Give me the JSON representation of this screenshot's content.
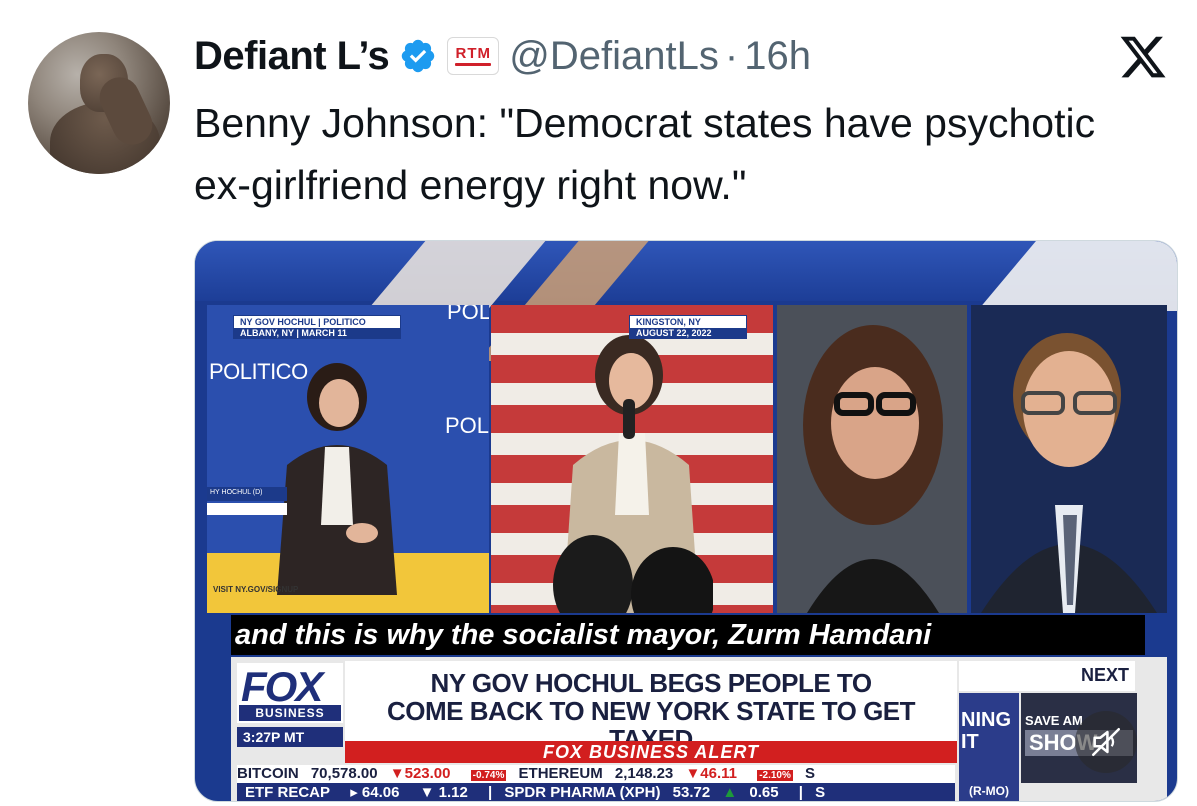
{
  "tweet": {
    "display_name": "Defiant L’s",
    "handle": "@DefiantLs",
    "separator": "·",
    "time": "16h",
    "affiliate_badge": "RTM",
    "text": "Benny Johnson: \"Democrat states have psychotic ex-girlfriend energy right now.\""
  },
  "colors": {
    "verified_blue": "#1d9bf0",
    "text_primary": "#0f1419",
    "text_secondary": "#536471",
    "fox_navy": "#1f2f7a",
    "alert_red": "#d21f1f"
  },
  "icons": {
    "verified": "verified-badge-icon",
    "x_logo": "x-logo-icon",
    "mute": "speaker-muted-icon"
  },
  "video": {
    "panel1": {
      "tag_top": "NY GOV HOCHUL | POLITICO",
      "tag_bottom": "ALBANY, NY | MARCH 11",
      "politico": "POLITICO",
      "politico_partial": "POL",
      "politico_top": "POL",
      "nametag": "HY HOCHUL (D)",
      "visit": "VISIT NY.GOV/SIGNUP"
    },
    "panel2": {
      "tag_top": "KINGSTON, NY",
      "tag_bottom": "AUGUST 22, 2022"
    },
    "caption": "and this is why the socialist mayor, Zurm Hamdani",
    "fox_logo": "FOX",
    "fox_business": "BUSINESS",
    "clock": "3:27P MT",
    "headline_line1": "NY GOV HOCHUL BEGS PEOPLE TO",
    "headline_line2": "COME BACK TO NEW YORK STATE TO GET TAXED",
    "alert": "FOX BUSINESS ALERT",
    "next": "NEXT",
    "promo1": "NING IT",
    "promo2_top": "SAVE AM",
    "promo2_show": "SHOW",
    "rmo": "(R-MO)",
    "ticker1": {
      "bitcoin_label": "BITCOIN",
      "bitcoin_value": "70,578.00",
      "bitcoin_change": "523.00",
      "bitcoin_pct": "-0.74%",
      "eth_label": "ETHEREUM",
      "eth_value": "2,148.23",
      "eth_change": "46.11",
      "eth_pct": "-2.10%",
      "tail": "S"
    },
    "ticker2": {
      "etf_label": "ETF RECAP",
      "v1": "64.06",
      "v2": "1.12",
      "sep": "|",
      "spdr_label": "SPDR PHARMA (XPH)",
      "spdr_value": "53.72",
      "spdr_change": "0.65",
      "tail": "S"
    }
  }
}
